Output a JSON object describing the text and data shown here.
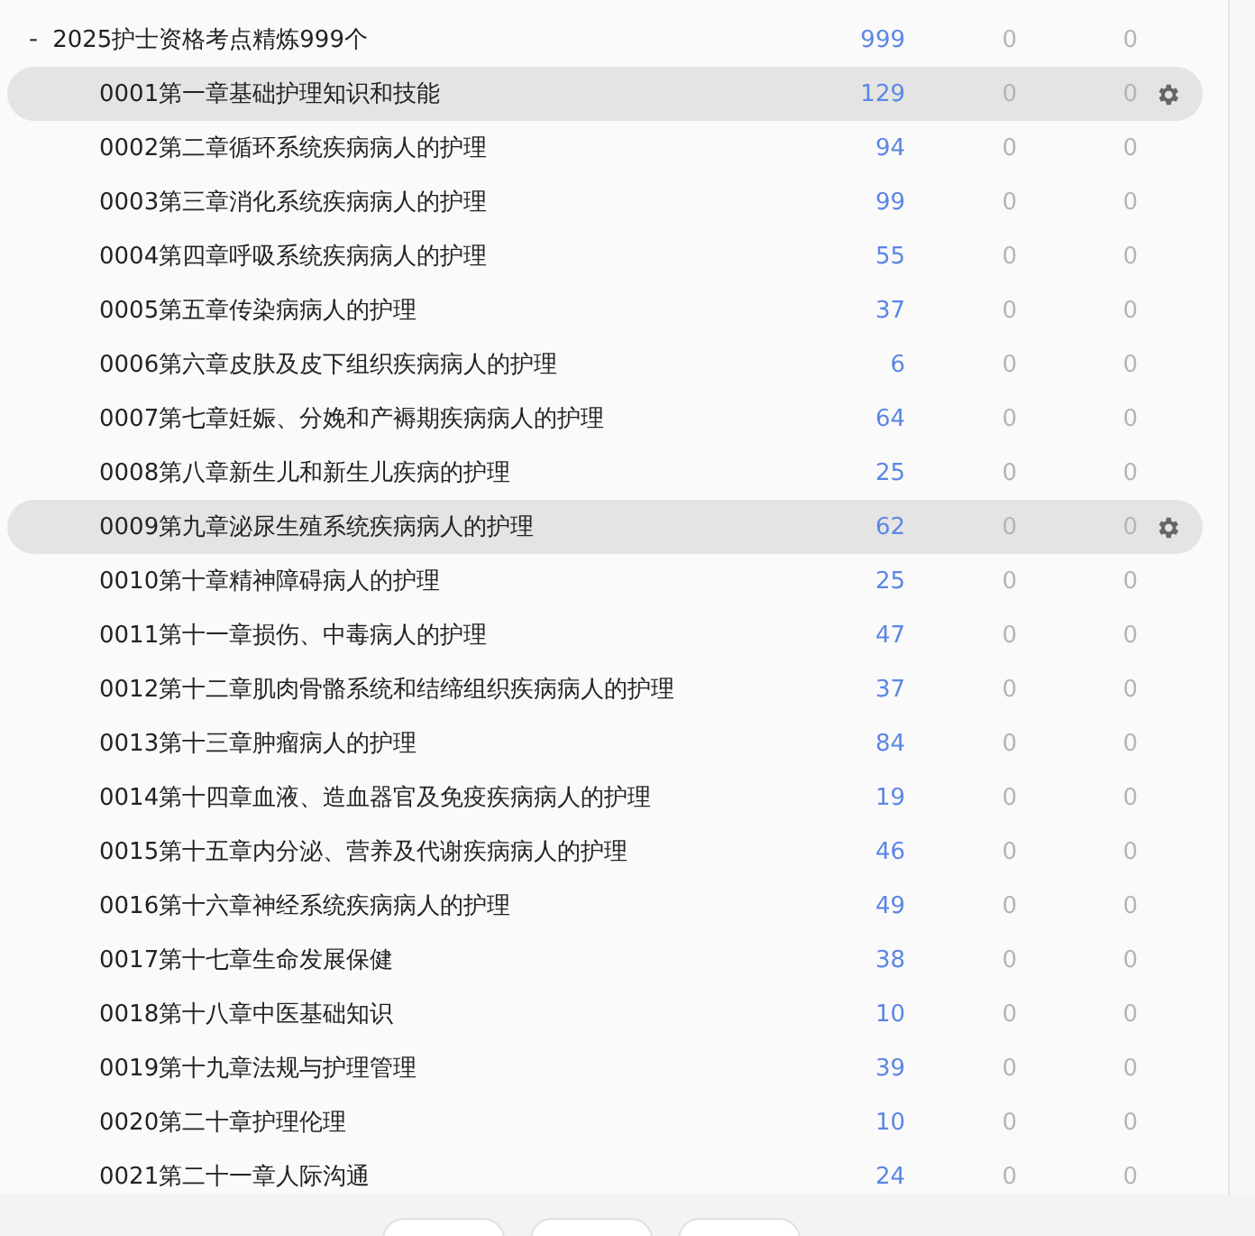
{
  "root": {
    "toggle": "-",
    "title": "2025护士资格考点精炼999个",
    "count": "999",
    "col_2": "0",
    "col_3": "0"
  },
  "chapters": [
    {
      "title": "0001第一章基础护理知识和技能",
      "count": "129",
      "col_2": "0",
      "col_3": "0",
      "selected": true
    },
    {
      "title": "0002第二章循环系统疾病病人的护理",
      "count": "94",
      "col_2": "0",
      "col_3": "0",
      "selected": false
    },
    {
      "title": "0003第三章消化系统疾病病人的护理",
      "count": "99",
      "col_2": "0",
      "col_3": "0",
      "selected": false
    },
    {
      "title": "0004第四章呼吸系统疾病病人的护理",
      "count": "55",
      "col_2": "0",
      "col_3": "0",
      "selected": false
    },
    {
      "title": "0005第五章传染病病人的护理",
      "count": "37",
      "col_2": "0",
      "col_3": "0",
      "selected": false
    },
    {
      "title": "0006第六章皮肤及皮下组织疾病病人的护理",
      "count": "6",
      "col_2": "0",
      "col_3": "0",
      "selected": false
    },
    {
      "title": "0007第七章妊娠、分娩和产褥期疾病病人的护理",
      "count": "64",
      "col_2": "0",
      "col_3": "0",
      "selected": false
    },
    {
      "title": "0008第八章新生儿和新生儿疾病的护理",
      "count": "25",
      "col_2": "0",
      "col_3": "0",
      "selected": false
    },
    {
      "title": "0009第九章泌尿生殖系统疾病病人的护理",
      "count": "62",
      "col_2": "0",
      "col_3": "0",
      "selected": true
    },
    {
      "title": "0010第十章精神障碍病人的护理",
      "count": "25",
      "col_2": "0",
      "col_3": "0",
      "selected": false
    },
    {
      "title": "0011第十一章损伤、中毒病人的护理",
      "count": "47",
      "col_2": "0",
      "col_3": "0",
      "selected": false
    },
    {
      "title": "0012第十二章肌肉骨骼系统和结缔组织疾病病人的护理",
      "count": "37",
      "col_2": "0",
      "col_3": "0",
      "selected": false
    },
    {
      "title": "0013第十三章肿瘤病人的护理",
      "count": "84",
      "col_2": "0",
      "col_3": "0",
      "selected": false
    },
    {
      "title": "0014第十四章血液、造血器官及免疫疾病病人的护理",
      "count": "19",
      "col_2": "0",
      "col_3": "0",
      "selected": false
    },
    {
      "title": "0015第十五章内分泌、营养及代谢疾病病人的护理",
      "count": "46",
      "col_2": "0",
      "col_3": "0",
      "selected": false
    },
    {
      "title": "0016第十六章神经系统疾病病人的护理",
      "count": "49",
      "col_2": "0",
      "col_3": "0",
      "selected": false
    },
    {
      "title": "0017第十七章生命发展保健",
      "count": "38",
      "col_2": "0",
      "col_3": "0",
      "selected": false
    },
    {
      "title": "0018第十八章中医基础知识",
      "count": "10",
      "col_2": "0",
      "col_3": "0",
      "selected": false
    },
    {
      "title": "0019第十九章法规与护理管理",
      "count": "39",
      "col_2": "0",
      "col_3": "0",
      "selected": false
    },
    {
      "title": "0020第二十章护理伦理",
      "count": "10",
      "col_2": "0",
      "col_3": "0",
      "selected": false
    },
    {
      "title": "0021第二十一章人际沟通",
      "count": "24",
      "col_2": "0",
      "col_3": "0",
      "selected": false
    }
  ],
  "footer_buttons": [
    {
      "kind": "button"
    },
    {
      "kind": "button"
    },
    {
      "kind": "button"
    }
  ]
}
